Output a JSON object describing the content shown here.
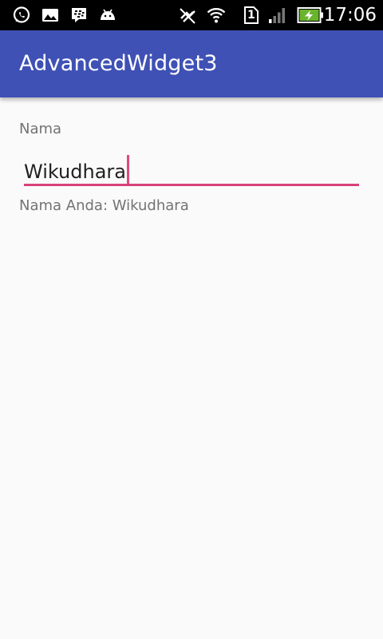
{
  "status_bar": {
    "time": "17:06",
    "sim_slot": "1",
    "icons": [
      "whatsapp-icon",
      "gallery-icon",
      "bbm-icon",
      "android-debug-icon",
      "mute-icon",
      "wifi-icon",
      "sim-icon",
      "signal-icon",
      "battery-charging-icon"
    ]
  },
  "app_bar": {
    "title": "AdvancedWidget3",
    "color": "#3f51b5"
  },
  "form": {
    "label": "Nama",
    "input_value": "Wikudhara",
    "output": "Nama Anda: Wikudhara",
    "accent_color": "#d8417a"
  }
}
